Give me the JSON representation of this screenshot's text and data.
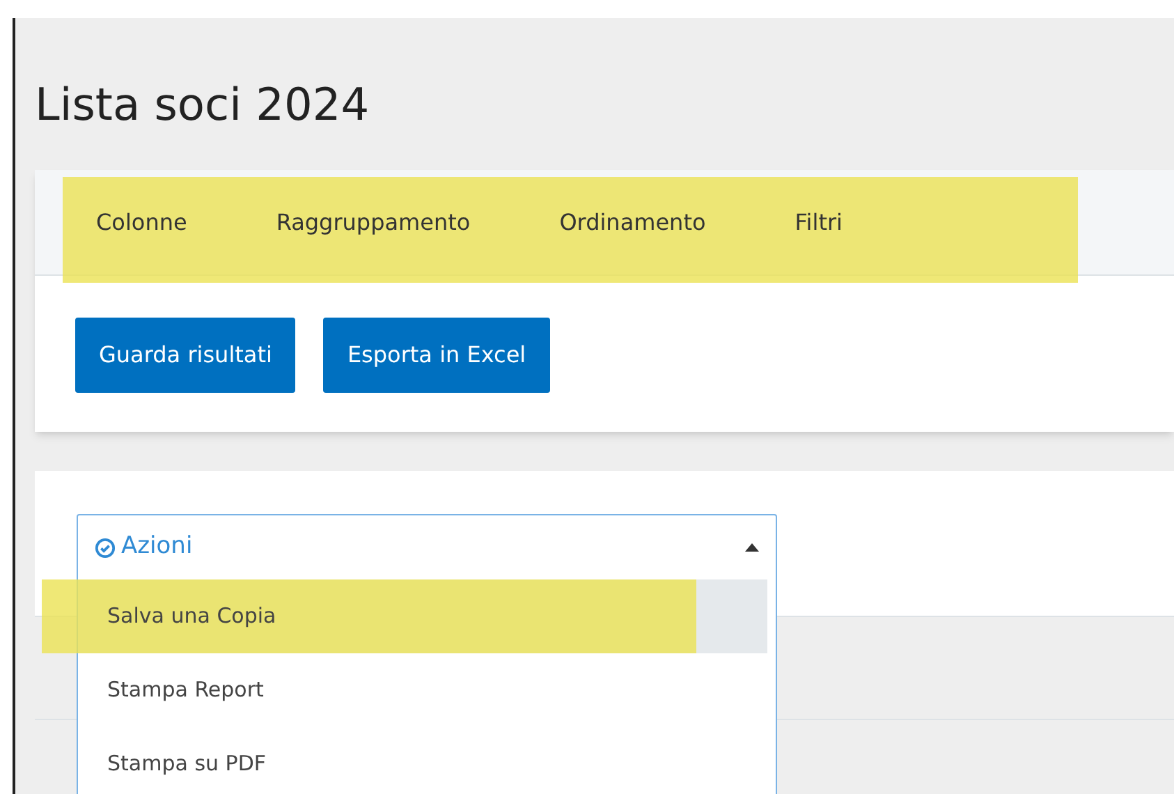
{
  "page_title": "Lista soci 2024",
  "tabs_highlighted": true,
  "tabs": [
    {
      "label": "Colonne"
    },
    {
      "label": "Raggruppamento"
    },
    {
      "label": "Ordinamento"
    },
    {
      "label": "Filtri"
    }
  ],
  "buttons": [
    "Guarda risultati",
    "Esporta in Excel"
  ],
  "actions_dropdown": {
    "label": "Azioni",
    "expanded": true,
    "items": [
      {
        "label": "Salva una Copia",
        "selected": true,
        "highlighted": true
      },
      {
        "label": "Stampa Report",
        "selected": false,
        "highlighted": false
      },
      {
        "label": "Stampa su PDF",
        "selected": false,
        "highlighted": false
      }
    ]
  }
}
